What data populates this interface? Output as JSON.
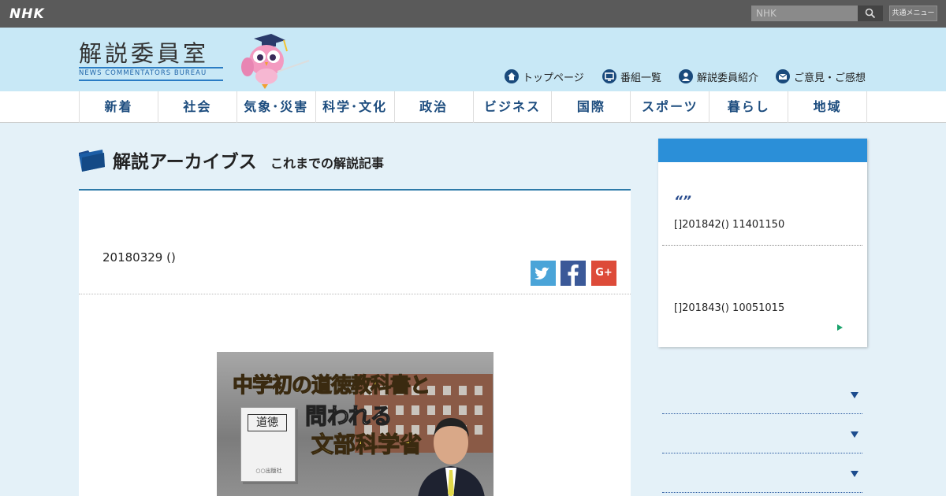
{
  "topbar": {
    "logo": "NHK",
    "search_placeholder": "NHK",
    "common_menu": "共通メニュー"
  },
  "header": {
    "site_title": "解説委員室",
    "site_subtitle": "NEWS COMMENTATORS BUREAU",
    "util_nav": [
      {
        "label": "トップページ",
        "icon": "home-icon"
      },
      {
        "label": "番組一覧",
        "icon": "tv-icon"
      },
      {
        "label": "解説委員紹介",
        "icon": "person-icon"
      },
      {
        "label": "ご意見・ご感想",
        "icon": "mail-icon"
      }
    ]
  },
  "category_nav": [
    "新着",
    "社会",
    "気象･災害",
    "科学･文化",
    "政治",
    "ビジネス",
    "国際",
    "スポーツ",
    "暮らし",
    "地域"
  ],
  "archive": {
    "title": "解説アーカイブス",
    "subtitle": "これまでの解説記事"
  },
  "article": {
    "date": "20180329 ()",
    "share": [
      "twitter-icon",
      "facebook-icon",
      "google-plus-icon"
    ],
    "google_plus_label": "G+",
    "thumbnail": {
      "headline_1": "中学初の道徳教科書と",
      "headline_2": "問われる",
      "headline_3": "文部科学省",
      "book_label": "道徳",
      "book_publisher": "○○出版社"
    }
  },
  "sidebar": {
    "quote_marks": "“”",
    "items": [
      {
        "text": "[]201842() 11401150"
      },
      {
        "text": "[]201843() 10051015"
      }
    ]
  },
  "colors": {
    "topbar": "#5a5a5a",
    "header": "#c8e8f6",
    "nav_text": "#1c4c7e",
    "sidebar_head": "#2b8fd8",
    "accent_rule": "#2e7aa8"
  }
}
